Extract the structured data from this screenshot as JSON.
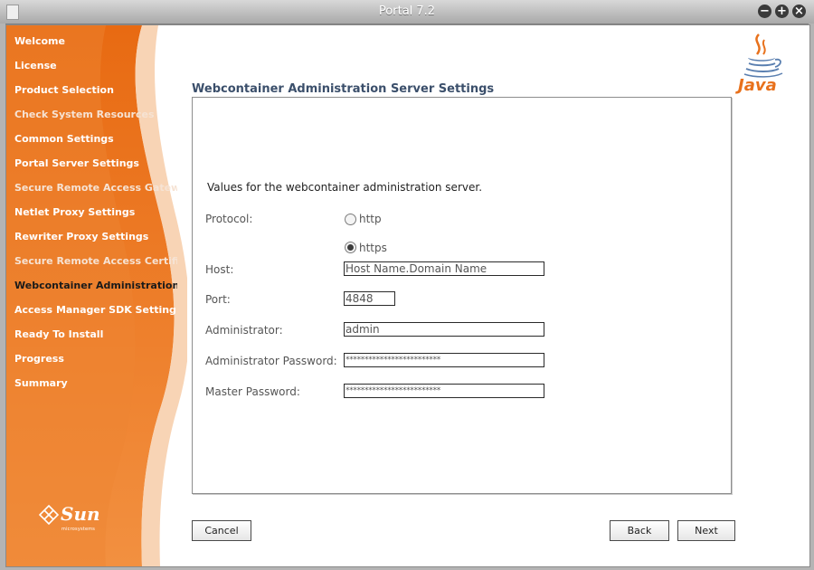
{
  "window": {
    "title": "Portal 7.2"
  },
  "sidebar": {
    "items": [
      {
        "label": "Welcome"
      },
      {
        "label": "License"
      },
      {
        "label": "Product Selection"
      },
      {
        "label": "Check System Resources"
      },
      {
        "label": "Common Settings"
      },
      {
        "label": "Portal Server Settings"
      },
      {
        "label": "Secure Remote Access Gatewa"
      },
      {
        "label": "Netlet Proxy Settings"
      },
      {
        "label": "Rewriter Proxy Settings"
      },
      {
        "label": "Secure Remote Access Certific"
      },
      {
        "label": "Webcontainer Administration S"
      },
      {
        "label": "Access Manager SDK Setting"
      },
      {
        "label": "Ready To Install"
      },
      {
        "label": "Progress"
      },
      {
        "label": "Summary"
      }
    ],
    "current_index": 10,
    "logo": {
      "brand": "Sun",
      "sub": "microsystems"
    }
  },
  "java_logo": {
    "text": "Java"
  },
  "main": {
    "heading": "Webcontainer Administration Server Settings",
    "intro": "Values for the webcontainer administration server.",
    "protocol": {
      "label": "Protocol:",
      "options": [
        {
          "label": "http",
          "selected": false
        },
        {
          "label": "https",
          "selected": true
        }
      ]
    },
    "host": {
      "label": "Host:",
      "value": "Host Name.Domain Name"
    },
    "port": {
      "label": "Port:",
      "value": "4848"
    },
    "administrator": {
      "label": "Administrator:",
      "value": "admin"
    },
    "admin_password": {
      "label": "Administrator Password:",
      "value": "*************************"
    },
    "master_password": {
      "label": "Master Password:",
      "value": "*************************"
    }
  },
  "buttons": {
    "cancel": "Cancel",
    "back": "Back",
    "next": "Next"
  },
  "colors": {
    "accent_orange": "#e8711c",
    "heading_blue": "#3b4f6b"
  }
}
